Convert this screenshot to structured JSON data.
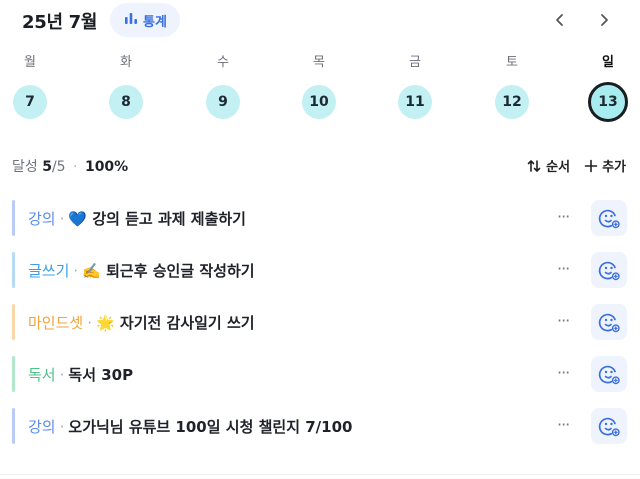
{
  "header": {
    "month_title": "25년 7월",
    "stats_label": "통계",
    "stats_icon": "bar-chart-icon",
    "prev_icon": "chevron-left-icon",
    "next_icon": "chevron-right-icon"
  },
  "week": {
    "days": [
      {
        "label": "월",
        "date": "7"
      },
      {
        "label": "화",
        "date": "8"
      },
      {
        "label": "수",
        "date": "9"
      },
      {
        "label": "목",
        "date": "10"
      },
      {
        "label": "금",
        "date": "11"
      },
      {
        "label": "토",
        "date": "12"
      },
      {
        "label": "일",
        "date": "13"
      }
    ],
    "selected_index": 6
  },
  "summary": {
    "label": "달성",
    "done": "5",
    "total": "/5",
    "percent": "100%"
  },
  "actions": {
    "sort_label": "순서",
    "add_label": "추가"
  },
  "items": [
    {
      "category": "강의",
      "emoji": "💙",
      "title": "강의 듣고 과제 제출하기",
      "color": "#5b8def"
    },
    {
      "category": "글쓰기",
      "emoji": "✍️",
      "title": "퇴근후 승인글 작성하기",
      "color": "#3aa0e8"
    },
    {
      "category": "마인드셋",
      "emoji": "🌟",
      "title": "자기전 감사일기 쓰기",
      "color": "#f2a33a"
    },
    {
      "category": "독서",
      "emoji": "",
      "title": "독서 30P",
      "color": "#4cc38a"
    },
    {
      "category": "강의",
      "emoji": "",
      "title": "오가닉님 유튜브 100일 시청 챌린지 7/100",
      "color": "#5b8def"
    }
  ],
  "colors": {
    "accent": "#3a6fe0",
    "day_circle": "#c3f0f3"
  }
}
